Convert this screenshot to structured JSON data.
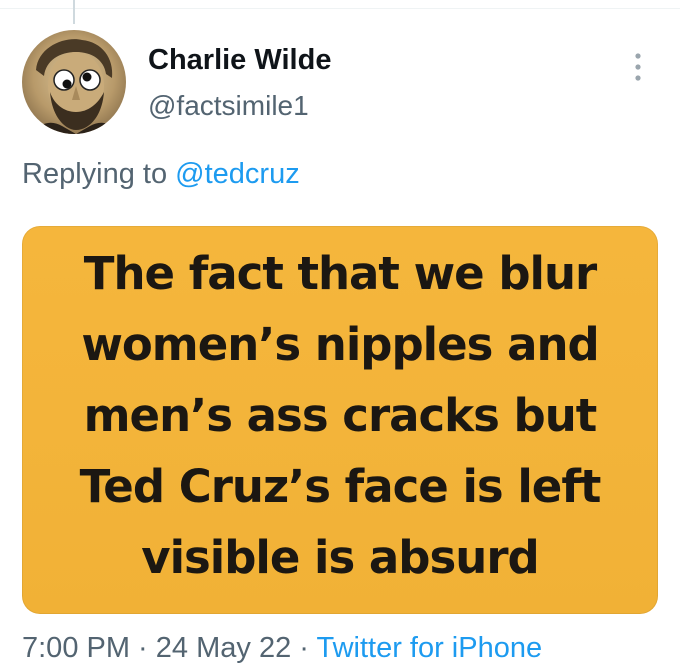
{
  "tweet": {
    "author": {
      "display_name": "Charlie Wilde",
      "handle": "@factsimile1",
      "avatar_icon": "avatar-portrait"
    },
    "more_icon": "more-vertical-icon",
    "replying_prefix": "Replying to",
    "replying_to": "@tedcruz",
    "image_text": {
      "lines": [
        "The fact that we blur",
        "women’s nipples and",
        "men’s ass cracks but",
        "Ted Cruz’s face is left",
        "visible is absurd"
      ],
      "background_color": "#f4b43a",
      "text_color": "#1b1712"
    },
    "meta": {
      "time": "7:00 PM",
      "separator1": " · ",
      "date": "24 May 22",
      "separator2": " · ",
      "source": "Twitter for iPhone"
    }
  },
  "colors": {
    "accent": "#1d9bf0",
    "secondary_text": "#536471",
    "primary_text": "#0f1419"
  }
}
